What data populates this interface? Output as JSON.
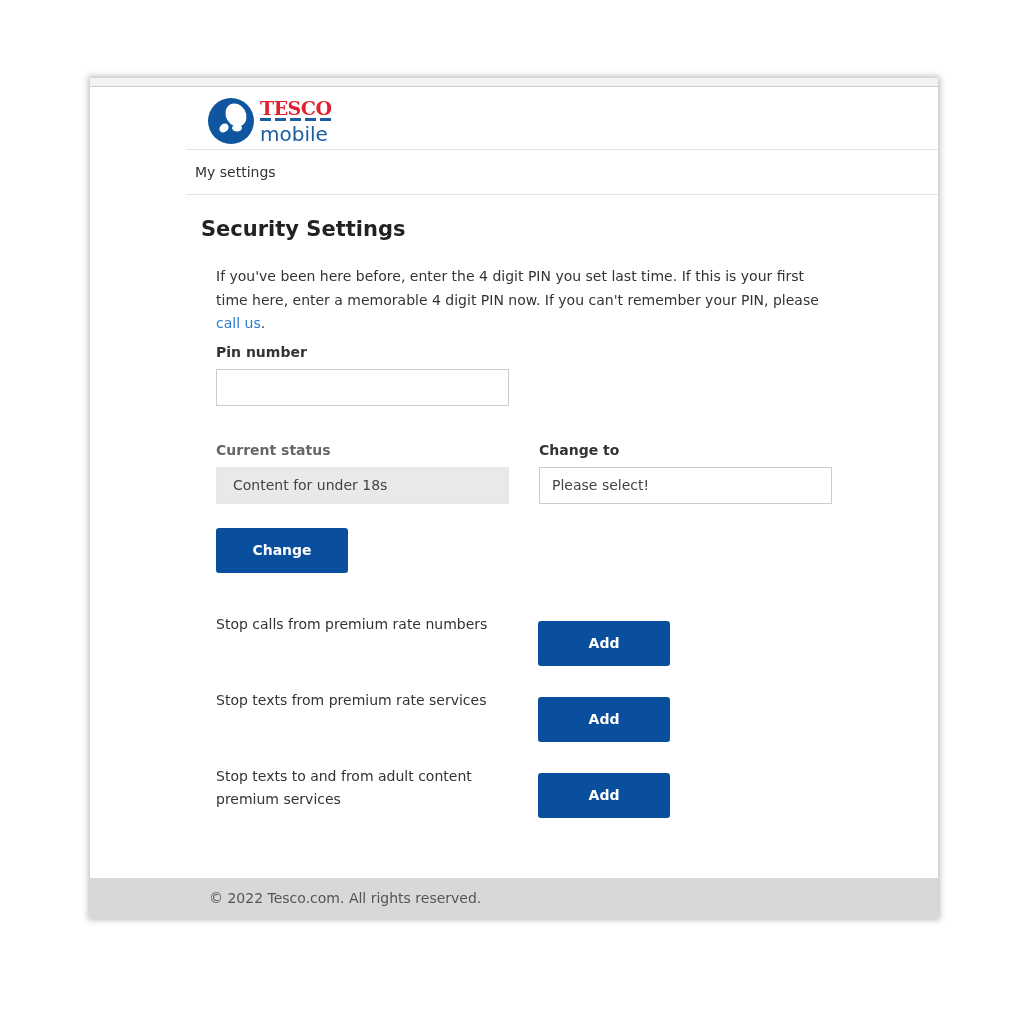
{
  "logo": {
    "brand": "TESCO",
    "product": "mobile"
  },
  "nav": {
    "label": "My settings"
  },
  "title": "Security Settings",
  "intro": {
    "text": "If you've been here before, enter the 4 digit PIN you set last time. If this is your first time here, enter a memorable 4 digit PIN now. If you can't remember your PIN, please",
    "link": "call us",
    "after": "."
  },
  "pin": {
    "label": "Pin number"
  },
  "current_status": {
    "label": "Current status",
    "value": "Content for under 18s",
    "disabled": true
  },
  "change_to": {
    "label": "Change to",
    "value": "Please select!"
  },
  "change_button": "Change",
  "options": [
    {
      "label": "Stop calls from premium rate numbers",
      "button": "Add"
    },
    {
      "label": "Stop texts from premium rate services",
      "button": "Add"
    },
    {
      "label": "Stop texts to and from adult content premium services",
      "button": "Add"
    }
  ],
  "footer": "© 2022 Tesco.com. All rights reserved."
}
